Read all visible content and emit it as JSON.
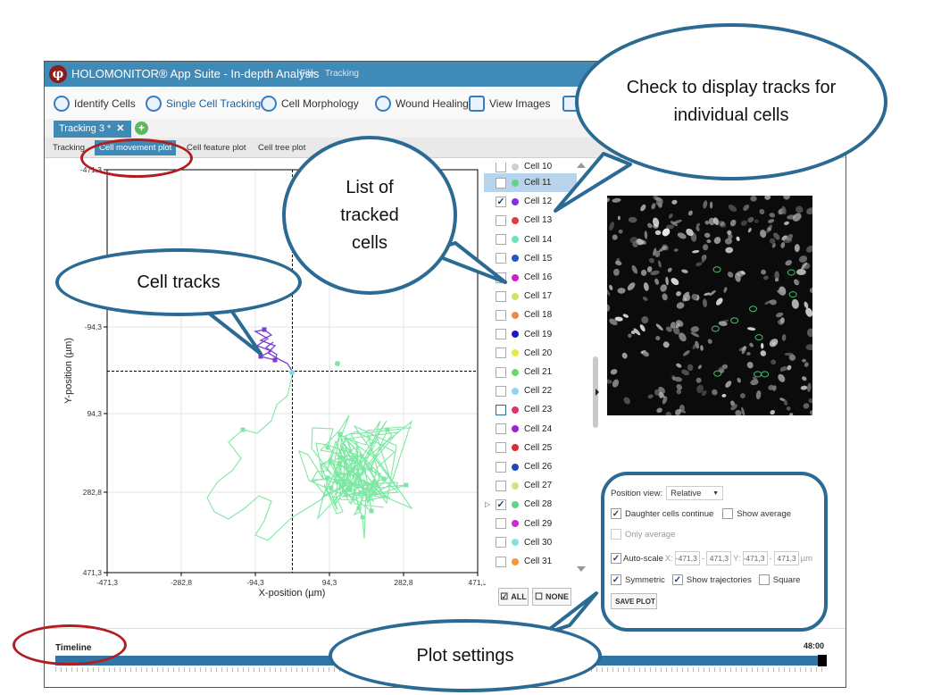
{
  "window": {
    "title": "HOLOMONITOR® App Suite - In-depth Analysis",
    "menu": [
      "File",
      "Tracking"
    ]
  },
  "toolbar": {
    "items": [
      "Identify Cells",
      "Single Cell Tracking",
      "Cell Morphology",
      "Wound Healing",
      "View Images"
    ],
    "active": "Single Cell Tracking"
  },
  "doc_tab": {
    "label": "Tracking 3 *",
    "close": "✕",
    "add": "+"
  },
  "subtabs": {
    "items": [
      "Tracking",
      "Cell movement plot",
      "Cell feature plot",
      "Cell tree plot"
    ],
    "active": "Cell movement plot"
  },
  "plot": {
    "xlabel": "X-position (µm)",
    "ylabel": "Y-position (µm)",
    "x_ticks": [
      "-471,3",
      "-282,8",
      "-94,3",
      "94,3",
      "282,8",
      "471,3"
    ],
    "y_ticks": [
      "-471,3",
      "-94,3",
      "94,3",
      "282,8",
      "471,3"
    ],
    "colors": {
      "purple_track": "#7a3fd0",
      "green_track": "#7de8a3",
      "cyan_point": "#7fd6e8"
    }
  },
  "cells": {
    "partial_top": "Cell 10",
    "items": [
      {
        "label": "Cell 11",
        "color": "#66d18c",
        "checked": false,
        "selected": true
      },
      {
        "label": "Cell 12",
        "color": "#8a2be2",
        "checked": true
      },
      {
        "label": "Cell 13",
        "color": "#e03a45",
        "checked": false
      },
      {
        "label": "Cell 14",
        "color": "#6fe0c0",
        "checked": false
      },
      {
        "label": "Cell 15",
        "color": "#2456c8",
        "checked": false
      },
      {
        "label": "Cell 16",
        "color": "#d21ec8",
        "checked": false
      },
      {
        "label": "Cell 17",
        "color": "#c7e866",
        "checked": false
      },
      {
        "label": "Cell 18",
        "color": "#ef8a3c",
        "checked": false
      },
      {
        "label": "Cell 19",
        "color": "#1a1acb",
        "checked": false
      },
      {
        "label": "Cell 20",
        "color": "#e9e84a",
        "checked": false
      },
      {
        "label": "Cell 21",
        "color": "#66d86d",
        "checked": false
      },
      {
        "label": "Cell 22",
        "color": "#8fd5ef",
        "checked": false
      },
      {
        "label": "Cell 23",
        "color": "#e5326d",
        "checked": false,
        "focused": true
      },
      {
        "label": "Cell 24",
        "color": "#a21ed8",
        "checked": false
      },
      {
        "label": "Cell 25",
        "color": "#e02c2c",
        "checked": false
      },
      {
        "label": "Cell 26",
        "color": "#2247c0",
        "checked": false
      },
      {
        "label": "Cell 27",
        "color": "#c5ea7a",
        "checked": false
      },
      {
        "label": "Cell 28",
        "color": "#66d18c",
        "checked": true,
        "expander": "▷"
      },
      {
        "label": "Cell 29",
        "color": "#cc2bd0",
        "checked": false
      },
      {
        "label": "Cell 30",
        "color": "#7fe6e0",
        "checked": false
      },
      {
        "label": "Cell 31",
        "color": "#f0983a",
        "checked": false
      }
    ],
    "all_label": "ALL",
    "none_label": "NONE"
  },
  "settings": {
    "position_view_label": "Position view:",
    "position_view_value": "Relative",
    "daughter_label": "Daughter cells continue",
    "show_average_label": "Show average",
    "only_average_label": "Only average",
    "autoscale_label": "Auto-scale",
    "x_label": "X:",
    "y_label": "Y:",
    "x_min": "-471,3",
    "x_max": "471,3",
    "y_min": "-471,3",
    "y_max": "471,3",
    "dash": "-",
    "unit": "µm",
    "symmetric_label": "Symmetric",
    "trajectories_label": "Show trajectories",
    "square_label": "Square",
    "save_label": "SAVE PLOT"
  },
  "timeline": {
    "label": "Timeline",
    "time": "48:00"
  },
  "callouts": {
    "display_tracks": "Check to display tracks for individual cells",
    "tracked_cells": "List of tracked cells",
    "cell_tracks": "Cell tracks",
    "plot_settings": "Plot settings"
  },
  "annotation_colors": {
    "callout_border": "#2a6a93",
    "ring": "#b01e22"
  }
}
